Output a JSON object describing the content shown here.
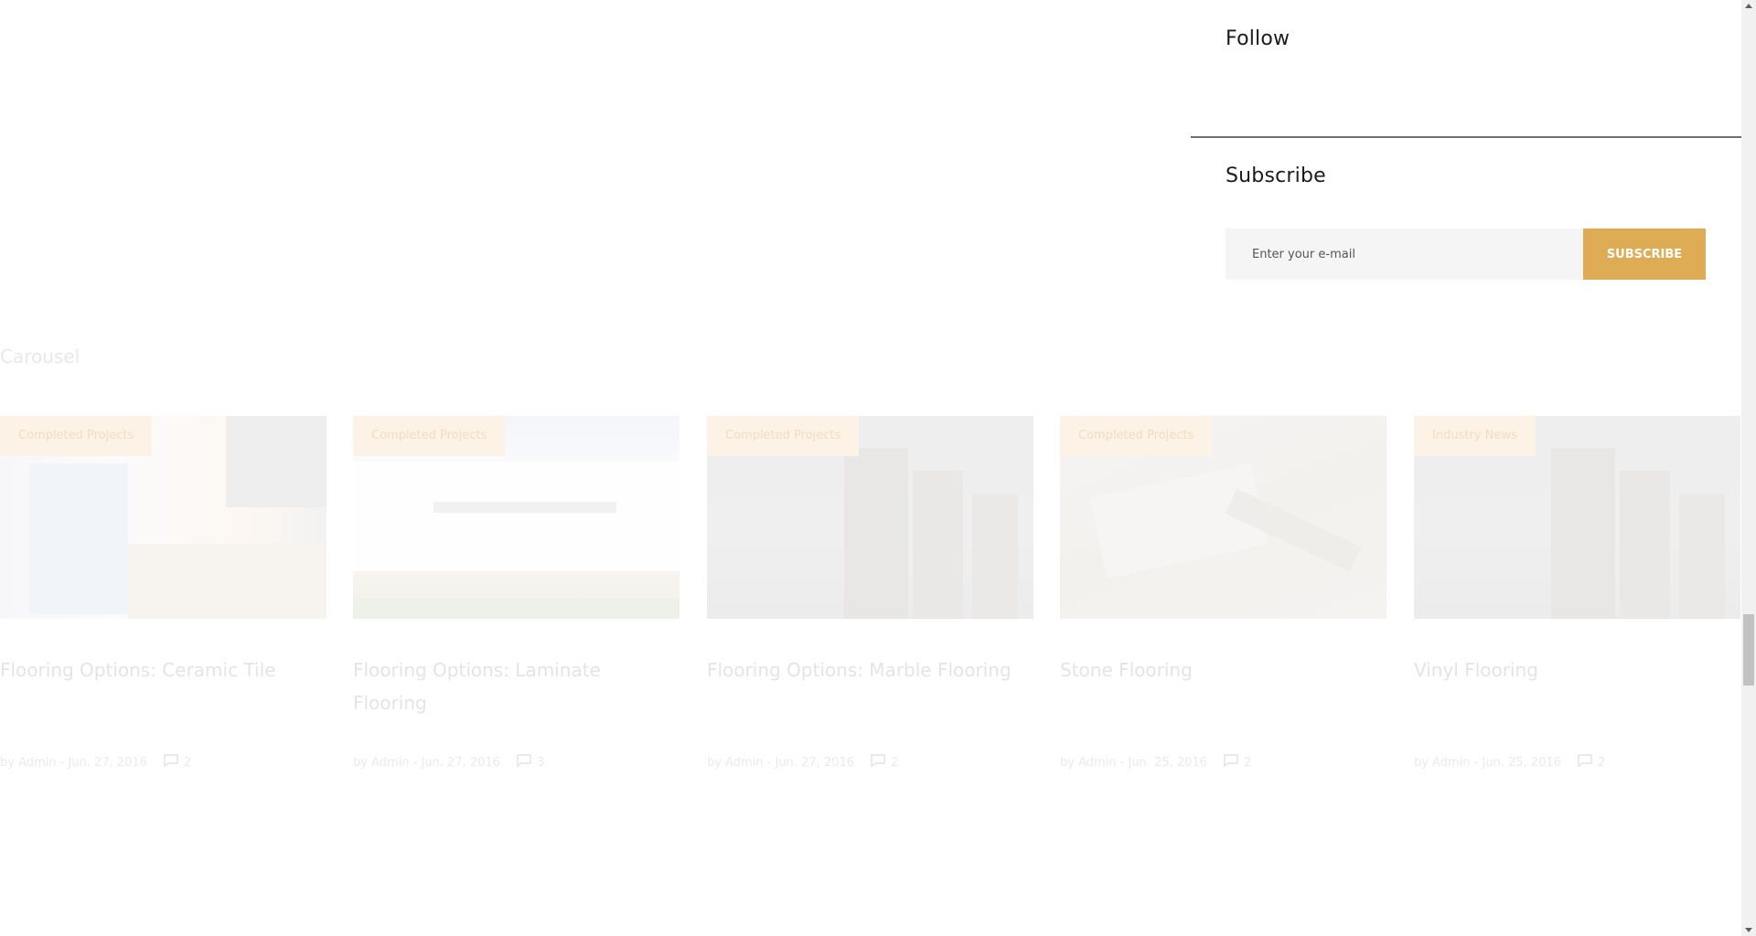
{
  "sidebar": {
    "follow_title": "Follow",
    "subscribe_title": "Subscribe",
    "email_placeholder": "Enter your e-mail",
    "subscribe_button": "SUBSCRIBE"
  },
  "carousel": {
    "heading": "Carousel",
    "items": [
      {
        "category": "Completed Projects",
        "title": "Flooring Options: Ceramic Tile",
        "author": "by Admin",
        "date": "Jun. 27, 2016",
        "comments": "2"
      },
      {
        "category": "Completed Projects",
        "title": "Flooring Options: Laminate Flooring",
        "author": "by Admin",
        "date": "Jun. 27, 2016",
        "comments": "3"
      },
      {
        "category": "Completed Projects",
        "title": "Flooring Options: Marble Flooring",
        "author": "by Admin",
        "date": "Jun. 27, 2016",
        "comments": "2"
      },
      {
        "category": "Completed Projects",
        "title": "Stone Flooring",
        "author": "by Admin",
        "date": "Jun. 25, 2016",
        "comments": "2"
      },
      {
        "category": "Industry News",
        "title": "Vinyl Flooring",
        "author": "by Admin",
        "date": "Jun. 25, 2016",
        "comments": "2"
      }
    ]
  },
  "colors": {
    "accent": "#dfac56",
    "badge_bg": "#fcf3e6"
  },
  "icons": {
    "comment": "comment-icon"
  }
}
